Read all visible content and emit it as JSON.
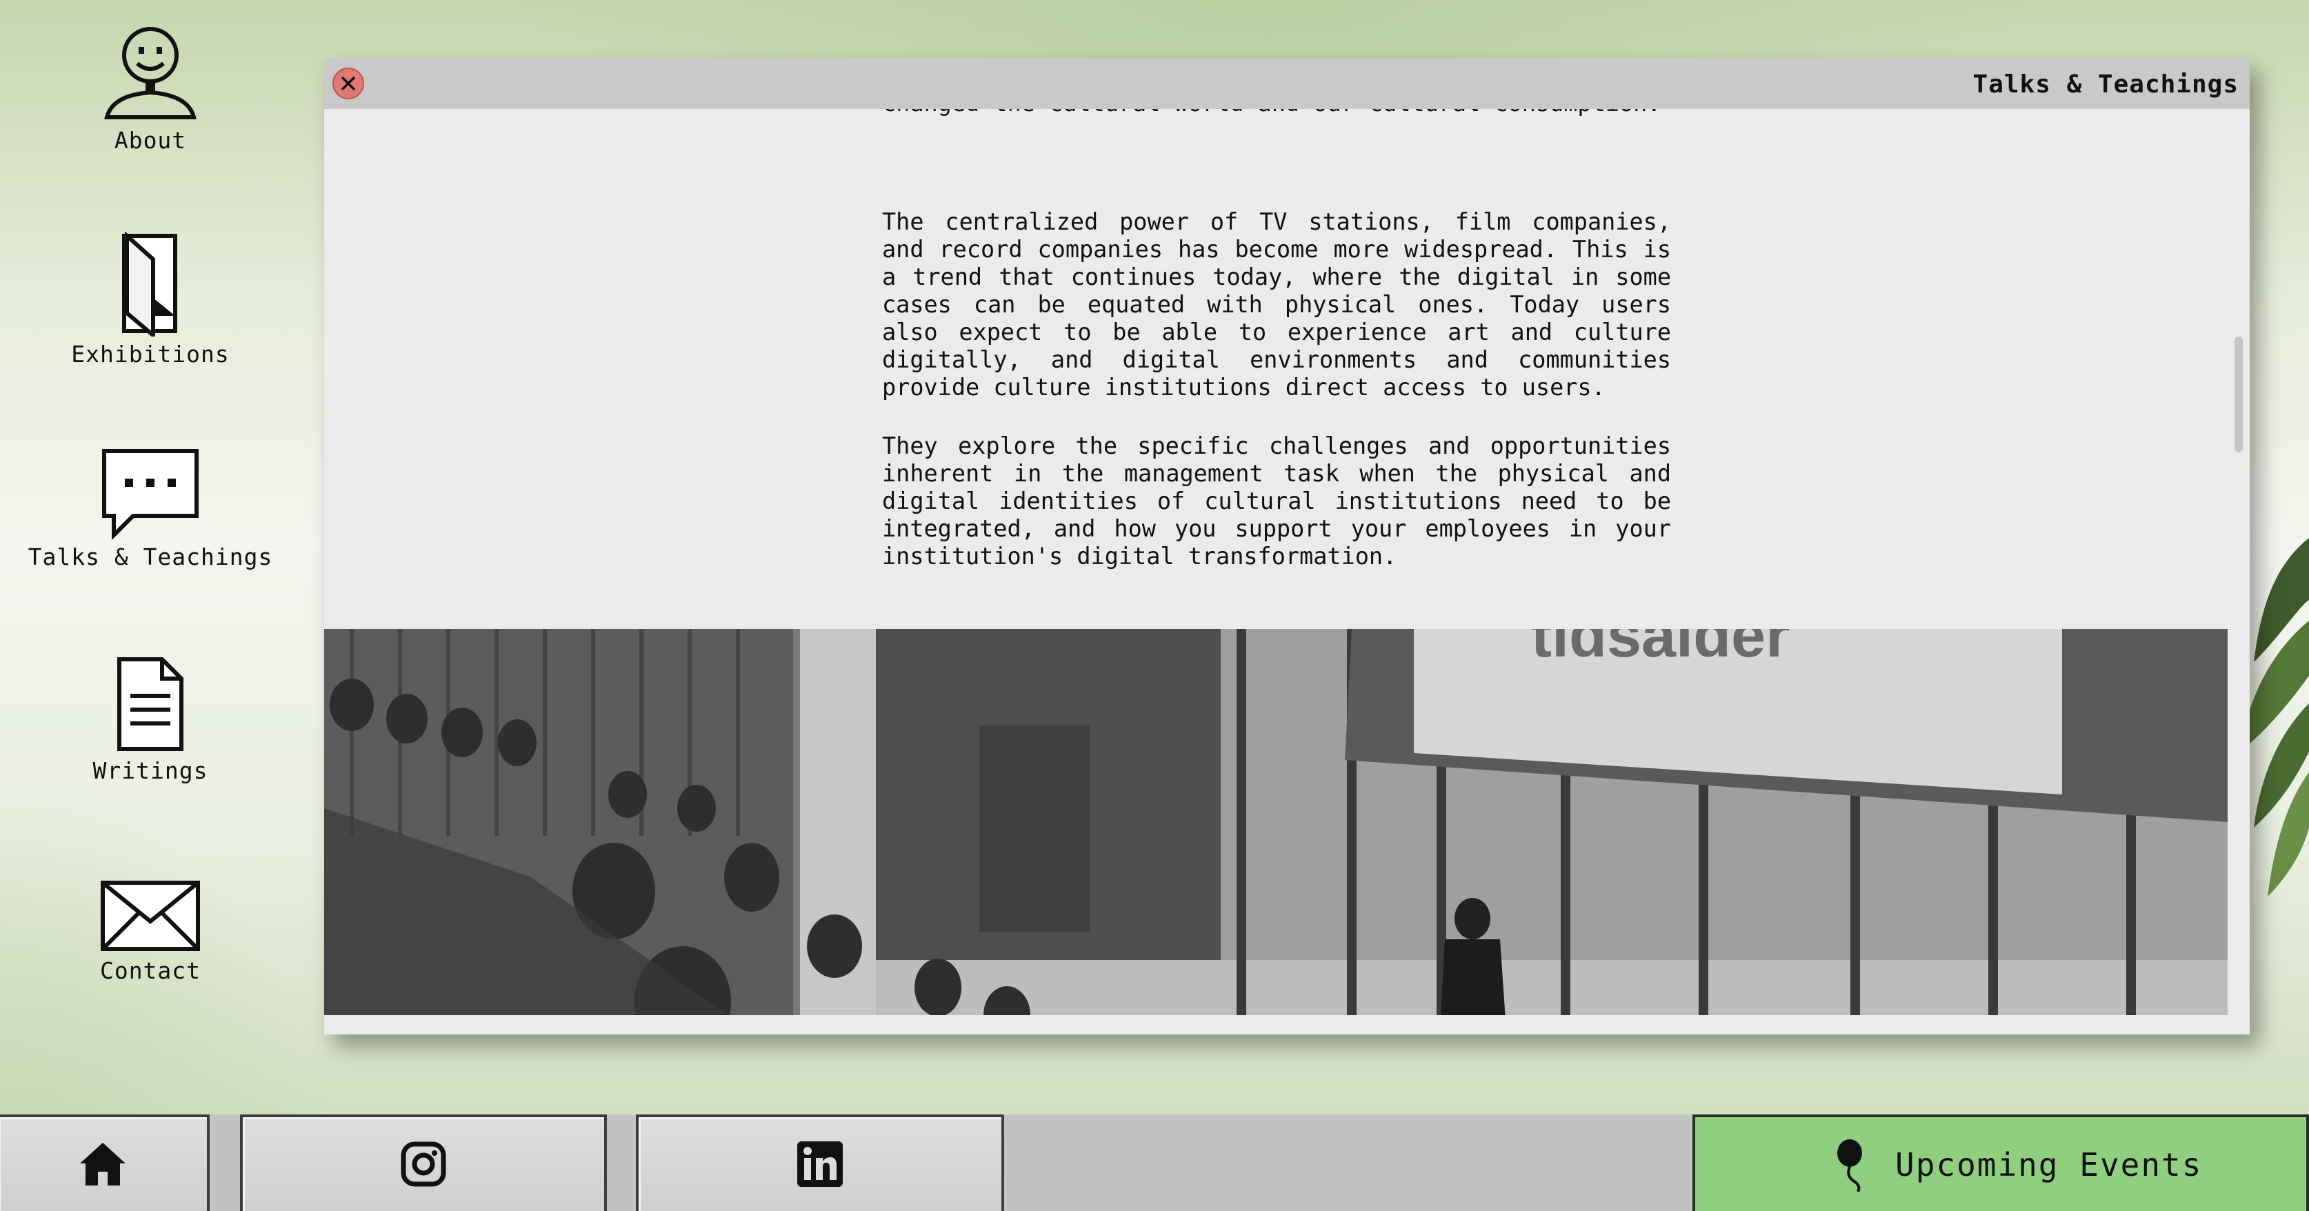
{
  "desktop": {
    "icons": [
      {
        "label": "About",
        "icon": "smiley-person-icon"
      },
      {
        "label": "Exhibitions",
        "icon": "door-icon"
      },
      {
        "label": "Talks & Teachings",
        "icon": "speech-bubble-icon"
      },
      {
        "label": "Writings",
        "icon": "document-icon"
      },
      {
        "label": "Contact",
        "icon": "envelope-icon"
      }
    ]
  },
  "window": {
    "title": "Talks & Teachings",
    "paragraphs": [
      "changed the cultural world and our cultural consumption.",
      "The centralized power of TV stations, film companies, and record companies has become more widespread. This is a trend that continues today, where the digital in some cases can be equated with physical ones. Today users also expect to be able to experience art and culture digitally, and digital environments and communities provide culture institutions direct access to users.",
      "They explore the specific challenges and opportunities inherent in the management task when the physical and digital identities of cultural institutions need to be integrated, and how you support your employees in your institution's digital transformation."
    ],
    "photo": {
      "screen_text": "tidsalder"
    }
  },
  "taskbar": {
    "home_icon": "home-icon",
    "instagram_icon": "instagram-icon",
    "linkedin_icon": "linkedin-icon",
    "events_label": "Upcoming Events",
    "events_icon": "balloon-pin-icon",
    "events_color": "#8fcf7f"
  }
}
